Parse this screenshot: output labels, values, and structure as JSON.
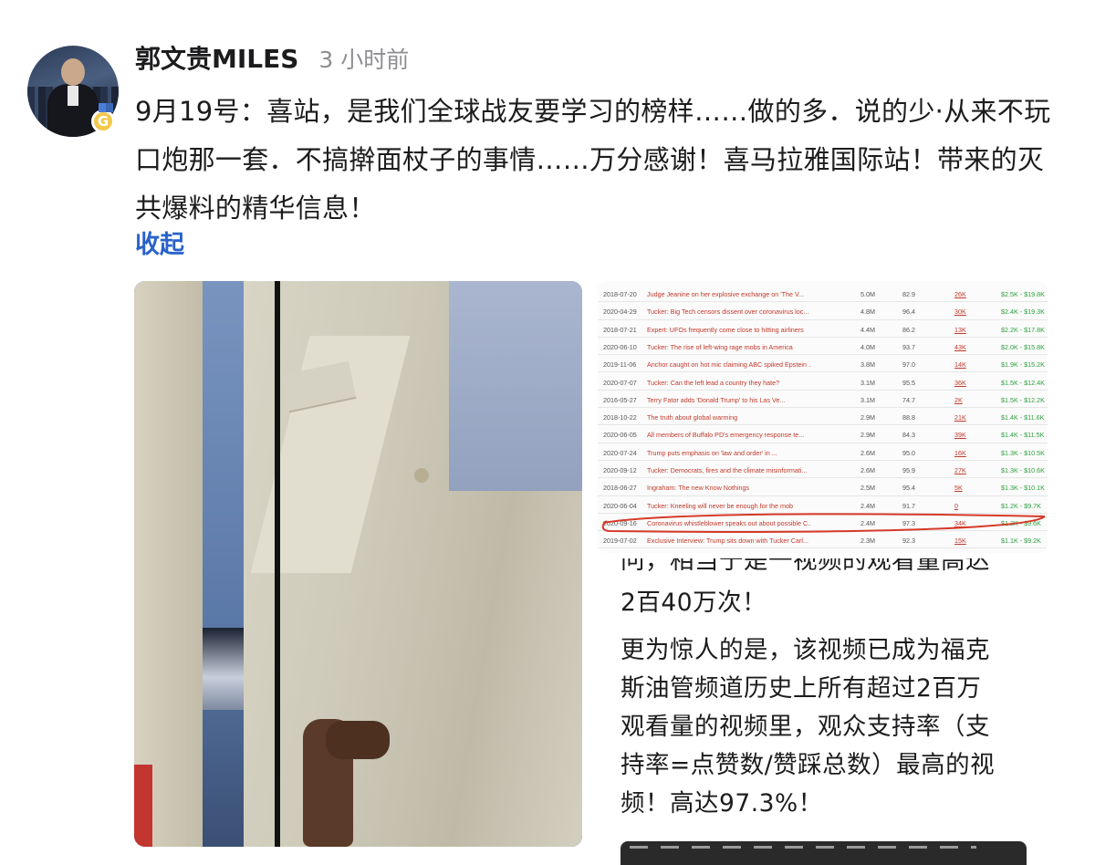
{
  "post": {
    "author": "郭文贵MILES",
    "time_ago": "3 小时前",
    "badge_letter": "G",
    "text": "9月19号：喜站，是我们全球战友要学习的榜样……做的多．说的少·从来不玩口炮那一套．不搞擀面杖子的事情……万分感谢！喜马拉雅国际站！带来的灭共爆料的精华信息！",
    "collapse_label": "收起"
  },
  "table_rows": [
    {
      "date": "2018-07-20",
      "title": "Judge Jeanine on her explosive exchange on 'The V...",
      "views": "5.0M",
      "score": "82.9",
      "likes": "26K",
      "money": "$2.5K - $19.8K"
    },
    {
      "date": "2020-04-29",
      "title": "Tucker: Big Tech censors dissent over coronavirus loc...",
      "views": "4.8M",
      "score": "96.4",
      "likes": "30K",
      "money": "$2.4K - $19.3K"
    },
    {
      "date": "2018-07-21",
      "title": "Expert: UFOs frequently come close to hitting airliners",
      "views": "4.4M",
      "score": "86.2",
      "likes": "13K",
      "money": "$2.2K - $17.8K"
    },
    {
      "date": "2020-06-10",
      "title": "Tucker: The rise of left-wing rage mobs in America",
      "views": "4.0M",
      "score": "93.7",
      "likes": "43K",
      "money": "$2.0K - $15.8K"
    },
    {
      "date": "2019-11-06",
      "title": "Anchor caught on hot mic claiming ABC spiked Epstein ...",
      "views": "3.8M",
      "score": "97.0",
      "likes": "14K",
      "money": "$1.9K - $15.2K"
    },
    {
      "date": "2020-07-07",
      "title": "Tucker: Can the left lead a country they hate?",
      "views": "3.1M",
      "score": "95.5",
      "likes": "36K",
      "money": "$1.5K - $12.4K"
    },
    {
      "date": "2016-05-27",
      "title": "Terry Fator adds 'Donald Trump' to his Las Ve...",
      "views": "3.1M",
      "score": "74.7",
      "likes": "2K",
      "money": "$1.5K - $12.2K"
    },
    {
      "date": "2018-10-22",
      "title": "The truth about global warming",
      "views": "2.9M",
      "score": "88.8",
      "likes": "21K",
      "money": "$1.4K - $11.6K"
    },
    {
      "date": "2020-06-05",
      "title": "All members of Buffalo PD's emergency response te...",
      "views": "2.9M",
      "score": "84.3",
      "likes": "39K",
      "money": "$1.4K - $11.5K"
    },
    {
      "date": "2020-07-24",
      "title": "Trump puts emphasis on 'law and order' in ...",
      "views": "2.6M",
      "score": "95.0",
      "likes": "16K",
      "money": "$1.3K - $10.5K"
    },
    {
      "date": "2020-09-12",
      "title": "Tucker: Democrats, fires and the climate misinformati...",
      "views": "2.6M",
      "score": "95.9",
      "likes": "27K",
      "money": "$1.3K - $10.6K"
    },
    {
      "date": "2018-06-27",
      "title": "Ingraham: The new Know Nothings",
      "views": "2.5M",
      "score": "95.4",
      "likes": "5K",
      "money": "$1.3K - $10.1K"
    },
    {
      "date": "2020-06-04",
      "title": "Tucker: Kneeling will never be enough for the mob",
      "views": "2.4M",
      "score": "91.7",
      "likes": "0",
      "money": "$1.2K - $9.7K"
    },
    {
      "date": "2020-09-16",
      "title": "Coronavirus whistleblower speaks out about possible C...",
      "views": "2.4M",
      "score": "97.3",
      "likes": "34K",
      "money": "$1.2K - $9.6K"
    },
    {
      "date": "2019-07-02",
      "title": "Exclusive Interview: Trump sits down with Tucker Carl...",
      "views": "2.3M",
      "score": "92.3",
      "likes": "15K",
      "money": "$1.1K - $9.2K"
    }
  ],
  "article": {
    "clipped_line": "问，相当于是一视频的观看量高达",
    "line_1": "2百40万次！",
    "line_2": "更为惊人的是，该视频已成为福克",
    "line_3": "斯油管频道历史上所有超过2百万",
    "line_4": "观看量的视频里，观众支持率（支",
    "line_5": "持率=点赞数/赞踩总数）最高的视",
    "line_6": "频！高达97.3%！"
  },
  "colors": {
    "link": "#2a62c9",
    "highlight_circle": "#d63a2a",
    "money_green": "#2e9e3e",
    "title_red": "#c0392b"
  }
}
